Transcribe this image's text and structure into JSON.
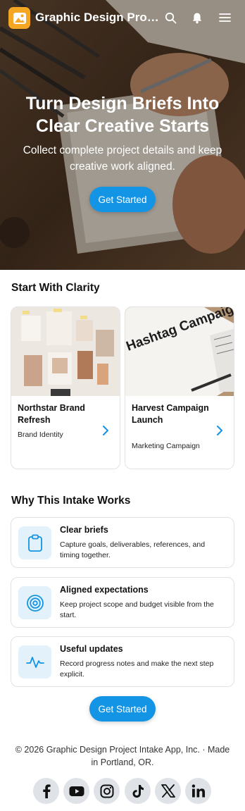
{
  "header": {
    "app_title": "Graphic Design Project Intake App",
    "logo_icon": "image-icon",
    "icons": [
      "search-icon",
      "notification-bell-icon",
      "menu-icon"
    ]
  },
  "hero": {
    "title": "Turn Design Briefs Into Clear Creative Starts",
    "subtitle": "Collect complete project details and keep creative work aligned.",
    "button_label": "Get Started"
  },
  "projects": {
    "heading": "Start With Clarity",
    "items": [
      {
        "name": "Northstar Brand Refresh",
        "category": "Brand Identity"
      },
      {
        "name": "Harvest Campaign Launch",
        "category": "Marketing Campaign",
        "image_text": "Hashtag Campaign"
      }
    ]
  },
  "features": {
    "heading": "Why This Intake Works",
    "items": [
      {
        "title": "Clear briefs",
        "description": "Capture goals, deliverables, references, and timing together.",
        "icon": "clipboard-icon"
      },
      {
        "title": "Aligned expectations",
        "description": "Keep project scope and budget visible from the start.",
        "icon": "target-icon"
      },
      {
        "title": "Useful updates",
        "description": "Record progress notes and make the next step explicit.",
        "icon": "activity-icon"
      }
    ]
  },
  "cta": {
    "button_label": "Get Started"
  },
  "footer": {
    "copyright": "© 2026 Graphic Design Project Intake App, Inc. · Made in Portland, OR.",
    "social": [
      "facebook-icon",
      "youtube-icon",
      "instagram-icon",
      "tiktok-icon",
      "x-icon",
      "linkedin-icon"
    ]
  },
  "colors": {
    "accent": "#1394e4",
    "logo": "#f5a623",
    "icon_bg": "#e3f1fb",
    "social_bg": "#dfe3e8"
  }
}
